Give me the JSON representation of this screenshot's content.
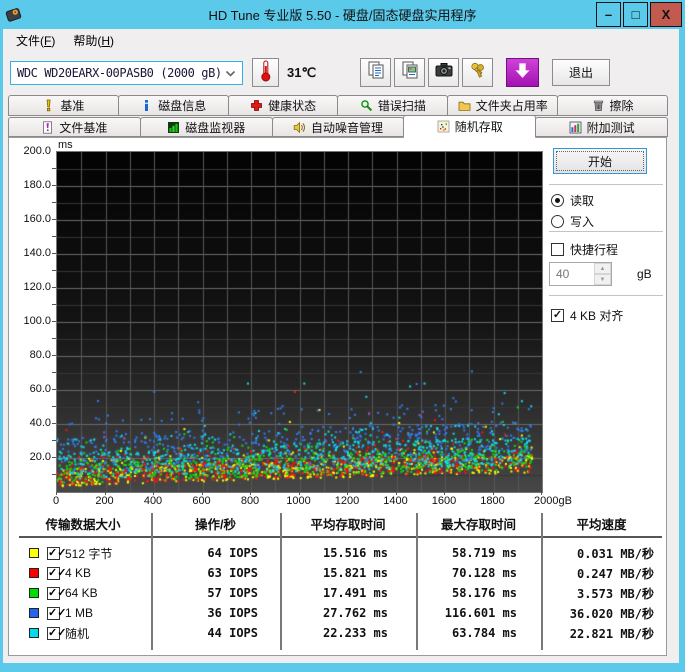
{
  "window": {
    "title": "HD Tune 专业版 5.50 - 硬盘/固态硬盘实用程序",
    "minimize_glyph": "–",
    "maximize_glyph": "□",
    "close_glyph": "X",
    "titlebar_color": "#5ac9ea",
    "close_button_color": "#c25a50"
  },
  "menu": {
    "items": [
      {
        "pre": "文件(",
        "key": "F",
        "post": ")"
      },
      {
        "pre": "帮助(",
        "key": "H",
        "post": ")"
      }
    ]
  },
  "toolbar": {
    "drive": "WDC WD20EARX-00PASB0 (2000 gB)",
    "temperature": "31℃",
    "exit_label": "退出",
    "icons": [
      "thermometer-icon",
      "copy-text-icon",
      "copy-image-icon",
      "camera-icon",
      "keys-icon",
      "save-icon"
    ]
  },
  "tabs": {
    "row1": [
      {
        "label": "基准",
        "icon": "benchmark-icon",
        "active": false
      },
      {
        "label": "磁盘信息",
        "icon": "disk-info-icon",
        "active": false
      },
      {
        "label": "健康状态",
        "icon": "health-icon",
        "active": false
      },
      {
        "label": "错误扫描",
        "icon": "error-scan-icon",
        "active": false
      },
      {
        "label": "文件夹占用率",
        "icon": "folder-usage-icon",
        "active": false
      },
      {
        "label": "擦除",
        "icon": "erase-icon",
        "active": false
      }
    ],
    "row2": [
      {
        "label": "文件基准",
        "icon": "file-benchmark-icon",
        "active": false
      },
      {
        "label": "磁盘监视器",
        "icon": "disk-monitor-icon",
        "active": false
      },
      {
        "label": "自动噪音管理",
        "icon": "aam-icon",
        "active": false
      },
      {
        "label": "随机存取",
        "icon": "random-access-icon",
        "active": true
      },
      {
        "label": "附加测试",
        "icon": "extra-tests-icon",
        "active": false
      }
    ]
  },
  "controls": {
    "start_label": "开始",
    "read_label": "读取",
    "write_label": "写入",
    "read_selected": true,
    "short_stroke_label": "快捷行程",
    "short_stroke_checked": false,
    "capacity_value": "40",
    "capacity_unit": "gB",
    "align_label": "4 KB 对齐",
    "align_checked": true
  },
  "chart_data": {
    "type": "scatter",
    "xlabel": "gB",
    "ylabel": "ms",
    "xlim": [
      0,
      2000
    ],
    "ylim": [
      0,
      200
    ],
    "x_tick_values": [
      0,
      200,
      400,
      600,
      800,
      1000,
      1200,
      1400,
      1600,
      1800,
      2000
    ],
    "x_tick_labels": [
      "0",
      "200",
      "400",
      "600",
      "800",
      "1000",
      "1200",
      "1400",
      "1600",
      "1800",
      "2000gB"
    ],
    "y_tick_values": [
      20,
      40,
      60,
      80,
      100,
      120,
      140,
      160,
      180,
      200
    ],
    "y_tick_labels": [
      "20.0",
      "40.0",
      "60.0",
      "80.0",
      "100.0",
      "120.0",
      "140.0",
      "160.0",
      "180.0",
      "200.0"
    ],
    "grid": {
      "x_interval": 100,
      "y_minor": 10,
      "y_major": 20,
      "on": true
    },
    "plot_bg_top": "#030303",
    "plot_bg_bottom": "#474747",
    "x_max_data": 1960,
    "seek_floor_ms": {
      "at_0": 3,
      "at_full": 11.5
    },
    "series": [
      {
        "name": "512 字节",
        "color": "#ffff00",
        "iops": 64,
        "avg_access_ms": 15.516,
        "max_access_ms": 58.719,
        "avg_speed_mb_s": 0.031,
        "points": 620,
        "band_lift": 0,
        "band_spread": 12
      },
      {
        "name": "4 KB",
        "color": "#ff1414",
        "iops": 63,
        "avg_access_ms": 15.821,
        "max_access_ms": 70.128,
        "avg_speed_mb_s": 0.247,
        "points": 620,
        "band_lift": 0.5,
        "band_spread": 13
      },
      {
        "name": "64 KB",
        "color": "#14d814",
        "iops": 57,
        "avg_access_ms": 17.491,
        "max_access_ms": 58.176,
        "avg_speed_mb_s": 3.573,
        "points": 600,
        "band_lift": 1.5,
        "band_spread": 15
      },
      {
        "name": "1 MB",
        "color": "#2f7cf2",
        "iops": 36,
        "avg_access_ms": 27.762,
        "max_access_ms": 116.601,
        "avg_speed_mb_s": 36.02,
        "points": 560,
        "band_lift": 7,
        "band_spread": 27
      },
      {
        "name": "随机",
        "color": "#12dce8",
        "iops": 44,
        "avg_access_ms": 22.233,
        "max_access_ms": 63.784,
        "avg_speed_mb_s": 22.821,
        "points": 560,
        "band_lift": 4,
        "band_spread": 20
      }
    ]
  },
  "table": {
    "headers": [
      "传输数据大小",
      "操作/秒",
      "平均存取时间",
      "最大存取时间",
      "平均速度"
    ],
    "rows": [
      {
        "color": "#ffff00",
        "checked": true,
        "label": "512 字节",
        "iops": "64 IOPS",
        "avg": "15.516 ms",
        "max": "58.719 ms",
        "speed": "0.031 MB/秒"
      },
      {
        "color": "#ff0000",
        "checked": true,
        "label": "4 KB",
        "iops": "63 IOPS",
        "avg": "15.821 ms",
        "max": "70.128 ms",
        "speed": "0.247 MB/秒"
      },
      {
        "color": "#00dd00",
        "checked": true,
        "label": "64 KB",
        "iops": "57 IOPS",
        "avg": "17.491 ms",
        "max": "58.176 ms",
        "speed": "3.573 MB/秒"
      },
      {
        "color": "#2266ee",
        "checked": true,
        "label": "1 MB",
        "iops": "36 IOPS",
        "avg": "27.762 ms",
        "max": "116.601 ms",
        "speed": "36.020 MB/秒"
      },
      {
        "color": "#00dde8",
        "checked": true,
        "label": "随机",
        "iops": "44 IOPS",
        "avg": "22.233 ms",
        "max": "63.784 ms",
        "speed": "22.821 MB/秒"
      }
    ]
  }
}
